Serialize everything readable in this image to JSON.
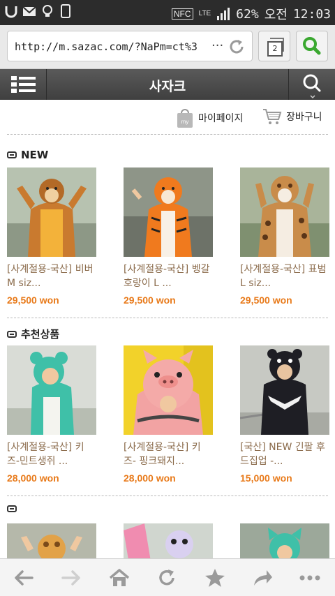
{
  "status_bar": {
    "nfc": "NFC",
    "network": "LTE",
    "battery": "62%",
    "am_pm": "오전",
    "time": "12:03"
  },
  "browser": {
    "url": "http://m.sazac.com/?NaPm=ct%3",
    "url_ellipsis": "···",
    "tab_count": "2"
  },
  "site": {
    "title": "사자크"
  },
  "user_links": {
    "mypage": "마이페이지",
    "mypage_badge": "my",
    "cart": "장바구니"
  },
  "sections": [
    {
      "title": "NEW",
      "products": [
        {
          "name": "[사계절용-국산] 비버 M siz...",
          "price": "29,500 won",
          "image": "beaver-kigurumi"
        },
        {
          "name": "[사계절용-국산] 벵갈 호랑이 L ...",
          "price": "29,500 won",
          "image": "tiger-kigurumi"
        },
        {
          "name": "[사계절용-국산] 표범 L siz...",
          "price": "29,500 won",
          "image": "leopard-kigurumi"
        }
      ]
    },
    {
      "title": "추천상품",
      "products": [
        {
          "name": "[사계절용-국산] 키즈-민트생쥐 ...",
          "price": "28,000 won",
          "image": "kids-mint-mouse"
        },
        {
          "name": "[사계절용-국산] 키즈- 핑크돼지...",
          "price": "28,000 won",
          "image": "kids-pink-pig"
        },
        {
          "name": "[국산] NEW 긴팔 후드집업 -...",
          "price": "15,000 won",
          "image": "bear-hood-zipup"
        }
      ]
    },
    {
      "title": "",
      "products": [
        {
          "image": "giraffe-kigurumi"
        },
        {
          "image": "pink-costume"
        },
        {
          "image": "mint-cat-costume"
        }
      ]
    }
  ],
  "colors": {
    "price": "#e87a1a",
    "product_name": "#8a6a4a",
    "site_bar": "#4a4a4a",
    "search_green": "#3aa830"
  },
  "bottom_nav": [
    "back-icon",
    "forward-icon",
    "home-icon",
    "refresh-icon",
    "bookmark-icon",
    "share-icon",
    "more-icon"
  ]
}
